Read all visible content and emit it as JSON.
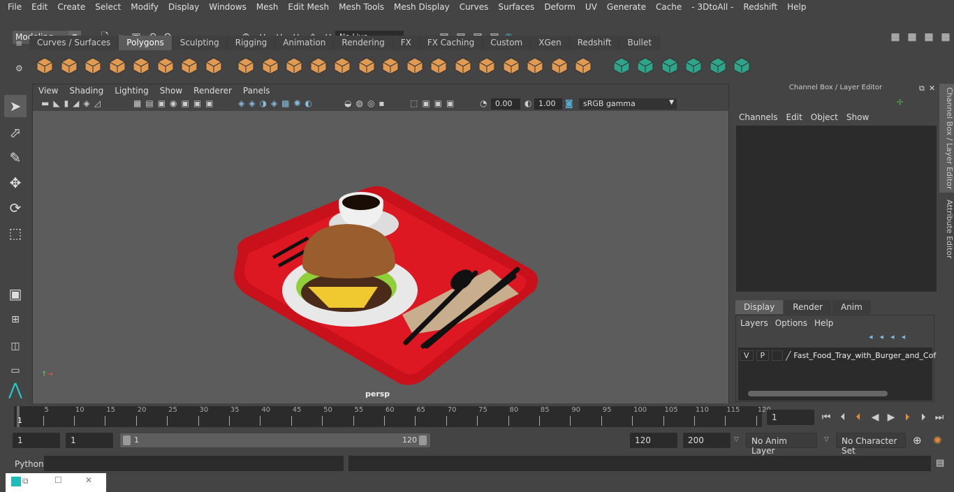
{
  "menu": [
    "File",
    "Edit",
    "Create",
    "Select",
    "Modify",
    "Display",
    "Windows",
    "Mesh",
    "Edit Mesh",
    "Mesh Tools",
    "Mesh Display",
    "Curves",
    "Surfaces",
    "Deform",
    "UV",
    "Generate",
    "Cache",
    "- 3DtoAll -",
    "Redshift",
    "Help"
  ],
  "toolbar": {
    "mode": "Modeling",
    "live_surface": "No Live Surface"
  },
  "shelf_tabs": [
    "Curves / Surfaces",
    "Polygons",
    "Sculpting",
    "Rigging",
    "Animation",
    "Rendering",
    "FX",
    "FX Caching",
    "Custom",
    "XGen",
    "Redshift",
    "Bullet"
  ],
  "active_shelf_tab": "Polygons",
  "shelf_icons": [
    "sphere",
    "cube",
    "cylinder",
    "cone",
    "plane",
    "torus",
    "pyramid",
    "pipe",
    "combine",
    "separate",
    "mirror",
    "smooth",
    "extrude",
    "bridge",
    "append",
    "multicut",
    "bevel",
    "bool",
    "fill-hole",
    "extract",
    "uv-tool",
    "uv-planar",
    "uv-cylindrical",
    "uv-auto",
    "uv-unfold",
    "uv-layout",
    "uv-editor",
    "uv-checker",
    "uv-sew"
  ],
  "viewport": {
    "menu": [
      "View",
      "Shading",
      "Lighting",
      "Show",
      "Renderer",
      "Panels"
    ],
    "exposure": "0.00",
    "gamma": "1.00",
    "colorspace": "sRGB gamma",
    "camera": "persp"
  },
  "channel_box": {
    "title": "Channel Box / Layer Editor",
    "menu": [
      "Channels",
      "Edit",
      "Object",
      "Show"
    ]
  },
  "layer_editor": {
    "tabs": [
      "Display",
      "Render",
      "Anim"
    ],
    "active_tab": "Display",
    "menu": [
      "Layers",
      "Options",
      "Help"
    ],
    "layer": {
      "v": "V",
      "p": "P",
      "name": "Fast_Food_Tray_with_Burger_and_Cof"
    }
  },
  "side_tabs": [
    "Channel Box / Layer Editor",
    "Attribute Editor"
  ],
  "timeline": {
    "ticks": [
      5,
      10,
      15,
      20,
      25,
      30,
      35,
      40,
      45,
      50,
      55,
      60,
      65,
      70,
      75,
      80,
      85,
      90,
      95,
      100,
      105,
      110,
      115,
      120
    ],
    "current_label": "1",
    "current_frame": "1"
  },
  "range": {
    "start": "1",
    "playback_start": "1",
    "slider_start": "1",
    "slider_end": "120",
    "playback_end": "120",
    "end": "200",
    "anim_layer": "No Anim Layer",
    "character_set": "No Character Set"
  },
  "command": {
    "language": "Python"
  },
  "colors": {
    "accent": "#5285a6",
    "shelf_icon": "#e09a52",
    "tray": "#d8141e"
  }
}
